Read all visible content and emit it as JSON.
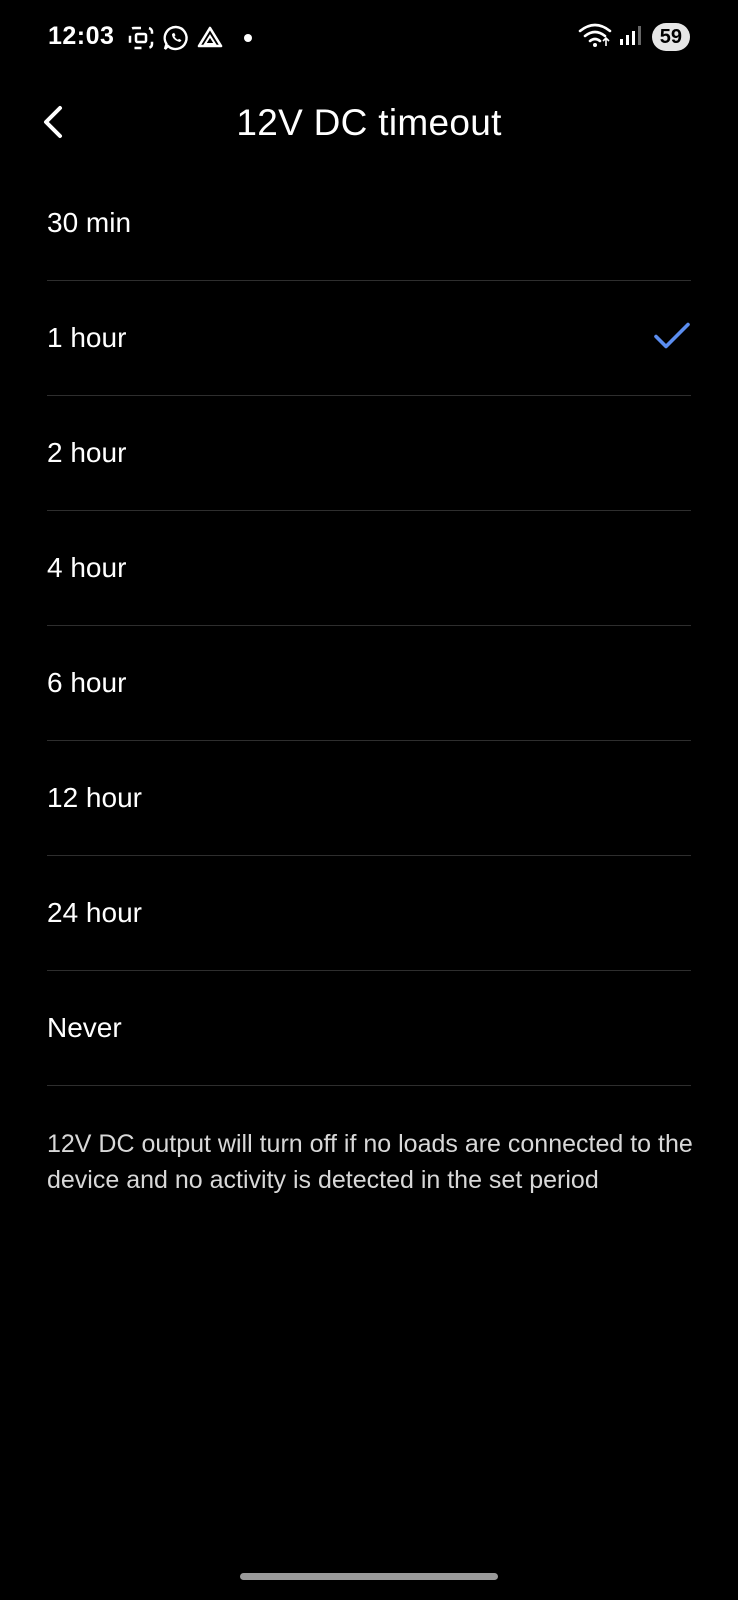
{
  "status_bar": {
    "time": "12:03",
    "battery": "59",
    "left_icons": [
      "screenshot-icon",
      "whatsapp-icon",
      "drive-icon",
      "notification-dot"
    ],
    "right_icons": [
      "wifi-icon",
      "signal-icon",
      "battery-icon"
    ]
  },
  "header": {
    "title": "12V DC timeout",
    "back_icon": "chevron-left-icon"
  },
  "options": [
    {
      "label": "30 min",
      "selected": false
    },
    {
      "label": "1 hour",
      "selected": true
    },
    {
      "label": "2 hour",
      "selected": false
    },
    {
      "label": "4 hour",
      "selected": false
    },
    {
      "label": "6 hour",
      "selected": false
    },
    {
      "label": "12 hour",
      "selected": false
    },
    {
      "label": "24 hour",
      "selected": false
    },
    {
      "label": "Never",
      "selected": false
    }
  ],
  "footnote": "12V DC output will turn off if no loads are connected to the device and no activity is detected in the set period",
  "colors": {
    "background": "#000000",
    "text": "#ffffff",
    "divider": "#2e2e2e",
    "accent_check": "#5b8def"
  }
}
